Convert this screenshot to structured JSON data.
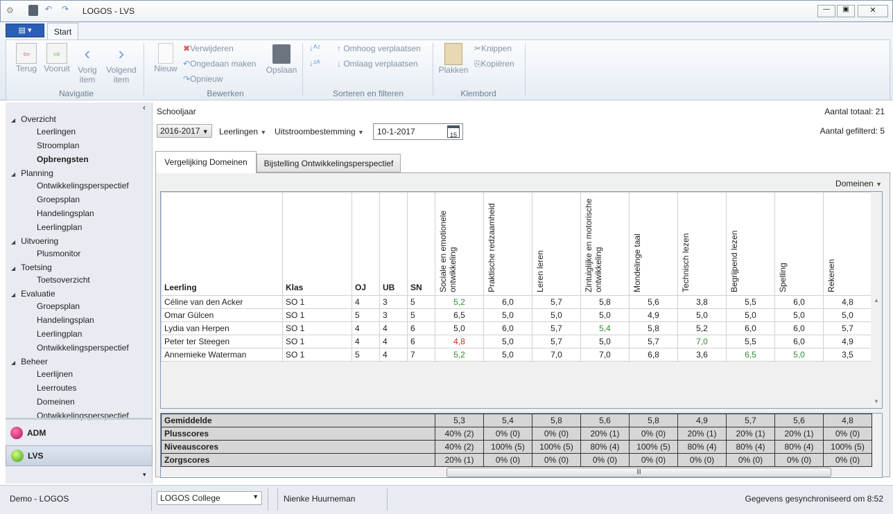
{
  "window": {
    "title": "LOGOS - LVS"
  },
  "ribbon": {
    "tab": "Start",
    "nav": {
      "back": "Terug",
      "forward": "Vooruit",
      "prev": "Vorig item",
      "next": "Volgend item",
      "group": "Navigatie"
    },
    "edit": {
      "new": "Nieuw",
      "delete": "Verwijderen",
      "undo": "Ongedaan maken",
      "redo": "Opnieuw",
      "save": "Opslaan",
      "group": "Bewerken"
    },
    "sort": {
      "up": "Omhoog verplaatsen",
      "down": "Omlaag verplaatsen",
      "group": "Sorteren en filteren"
    },
    "clip": {
      "paste": "Plakken",
      "cut": "Knippen",
      "copy": "Kopiëren",
      "group": "Klembord"
    }
  },
  "sidebar": {
    "groups": [
      {
        "label": "Overzicht",
        "items": [
          "Leerlingen",
          "Stroomplan",
          "Opbrengsten"
        ]
      },
      {
        "label": "Planning",
        "items": [
          "Ontwikkelingsperspectief",
          "Groepsplan",
          "Handelingsplan",
          "Leerlingplan"
        ]
      },
      {
        "label": "Uitvoering",
        "items": [
          "Plusmonitor"
        ]
      },
      {
        "label": "Toetsing",
        "items": [
          "Toetsoverzicht"
        ]
      },
      {
        "label": "Evaluatie",
        "items": [
          "Groepsplan",
          "Handelingsplan",
          "Leerlingplan",
          "Ontwikkelingsperspectief"
        ]
      },
      {
        "label": "Beheer",
        "items": [
          "Leerlijnen",
          "Leerroutes",
          "Domeinen",
          "Ontwikkelingsperspectief"
        ]
      }
    ],
    "selected": "Opbrengsten",
    "modules": [
      "ADM",
      "LVS"
    ]
  },
  "filters": {
    "schooljaar_label": "Schooljaar",
    "year": "2016-2017",
    "leerlingen": "Leerlingen",
    "uitstroom": "Uitstroombestemming",
    "date": "10-1-2017",
    "date_icon": "15",
    "total": "Aantal totaal: 21",
    "filtered": "Aantal gefilterd: 5"
  },
  "tabs": [
    "Vergelijking Domeinen",
    "Bijstelling Ontwikkelingsperspectief"
  ],
  "domeinen_label": "Domeinen",
  "grid": {
    "columns": [
      "Leerling",
      "Klas",
      "OJ",
      "UB",
      "SN",
      "Sociale en emotionele ontwikkeling",
      "Praktische redzaamheid",
      "Leren leren",
      "Zintuiglijke en motorische ontwikkeling",
      "Mondelinge taal",
      "Technisch lezen",
      "Begrijpend lezen",
      "Spelling",
      "Rekenen"
    ],
    "rows": [
      {
        "cells": [
          "Céline van den Acker",
          "SO 1",
          "4",
          "3",
          "5",
          "5,2",
          "6,0",
          "5,7",
          "5,8",
          "5,6",
          "3,8",
          "5,5",
          "6,0",
          "4,8"
        ],
        "colors": {
          "5": "green"
        }
      },
      {
        "cells": [
          "Omar Gülcen",
          "SO 1",
          "5",
          "3",
          "5",
          "6,5",
          "5,0",
          "5,0",
          "5,0",
          "4,9",
          "5,0",
          "5,0",
          "5,0",
          "5,0"
        ],
        "colors": {}
      },
      {
        "cells": [
          "Lydia van Herpen",
          "SO 1",
          "4",
          "4",
          "6",
          "5,0",
          "6,0",
          "5,7",
          "5,4",
          "5,8",
          "5,2",
          "6,0",
          "6,0",
          "5,7"
        ],
        "colors": {
          "8": "green"
        }
      },
      {
        "cells": [
          "Peter ter Steegen",
          "SO 1",
          "4",
          "4",
          "6",
          "4,8",
          "5,0",
          "5,7",
          "5,0",
          "5,7",
          "7,0",
          "5,5",
          "6,0",
          "4,9"
        ],
        "colors": {
          "5": "red",
          "10": "green"
        }
      },
      {
        "cells": [
          "Annemieke Waterman",
          "SO 1",
          "5",
          "4",
          "7",
          "5,2",
          "5,0",
          "7,0",
          "7,0",
          "6,8",
          "3,6",
          "6,5",
          "5,0",
          "3,5"
        ],
        "colors": {
          "5": "green",
          "11": "green",
          "12": "green"
        }
      }
    ]
  },
  "summary": [
    {
      "label": "Gemiddelde",
      "values": [
        "5,3",
        "5,4",
        "5,8",
        "5,6",
        "5,8",
        "4,9",
        "5,7",
        "5,6",
        "4,8"
      ]
    },
    {
      "label": "Plusscores",
      "values": [
        "40% (2)",
        "0% (0)",
        "0% (0)",
        "20% (1)",
        "0% (0)",
        "20% (1)",
        "20% (1)",
        "20% (1)",
        "0% (0)"
      ]
    },
    {
      "label": "Niveauscores",
      "values": [
        "40% (2)",
        "100% (5)",
        "100% (5)",
        "80% (4)",
        "100% (5)",
        "80% (4)",
        "80% (4)",
        "80% (4)",
        "100% (5)"
      ]
    },
    {
      "label": "Zorgscores",
      "values": [
        "20% (1)",
        "0% (0)",
        "0% (0)",
        "0% (0)",
        "0% (0)",
        "0% (0)",
        "0% (0)",
        "0% (0)",
        "0% (0)"
      ]
    }
  ],
  "status": {
    "left": "Demo - LOGOS",
    "school": "LOGOS College",
    "user": "Nienke Huurneman",
    "sync": "Gegevens gesynchroniseerd om 8:52"
  },
  "colors": {
    "green": "#2e8b2e",
    "red": "#e02020",
    "accent": "#2b5fb5"
  }
}
